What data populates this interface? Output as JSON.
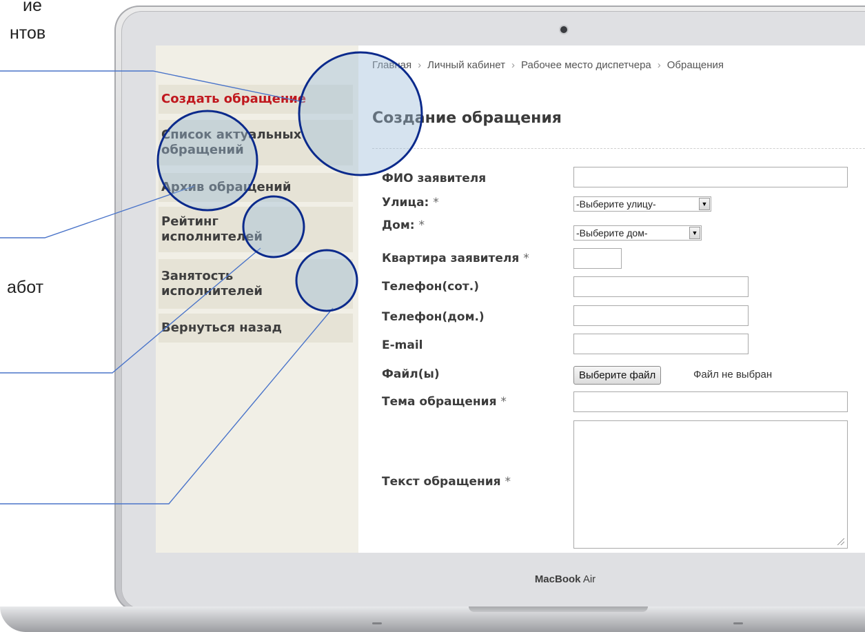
{
  "slide": {
    "text_fragments": [
      "ие",
      "нтов",
      "абот"
    ]
  },
  "laptop": {
    "brand_bold": "MacBook",
    "brand_light": " Air"
  },
  "breadcrumb": {
    "items": [
      "Главная",
      "Личный кабинет",
      "Рабочее место диспетчера",
      "Обращения"
    ],
    "separator": "›"
  },
  "sidebar": {
    "items": [
      {
        "label": "Создать обращение",
        "active": true
      },
      {
        "label": "Список актуальных обращений",
        "active": false
      },
      {
        "label": "Архив обращений",
        "active": false
      },
      {
        "label": "Рейтинг исполнителей",
        "active": false
      },
      {
        "label": "Занятость исполнителей",
        "active": false
      },
      {
        "label": "Вернуться назад",
        "active": false
      }
    ]
  },
  "page": {
    "title": "Создание обращения"
  },
  "form": {
    "required_mark": "*",
    "fio_label": "ФИО заявителя",
    "fio_value": "",
    "street_label": "Улица:",
    "street_value": "-Выберите улицу-",
    "house_label": "Дом:",
    "house_value": "-Выберите дом-",
    "apartment_label": "Квартира заявителя",
    "apartment_value": "",
    "mobile_label": "Телефон(сот.)",
    "mobile_value": "",
    "home_phone_label": "Телефон(дом.)",
    "home_phone_value": "",
    "email_label": "E-mail",
    "email_value": "",
    "files_label": "Файл(ы)",
    "file_button_label": "Выберите файл",
    "file_status": "Файл не выбран",
    "subject_label": "Тема обращения",
    "subject_value": "",
    "text_label": "Текст обращения",
    "text_value": ""
  },
  "colors": {
    "active_menu": "#c0171d",
    "annotation": "#0b2a8c",
    "callout_line": "#4a74c9"
  }
}
